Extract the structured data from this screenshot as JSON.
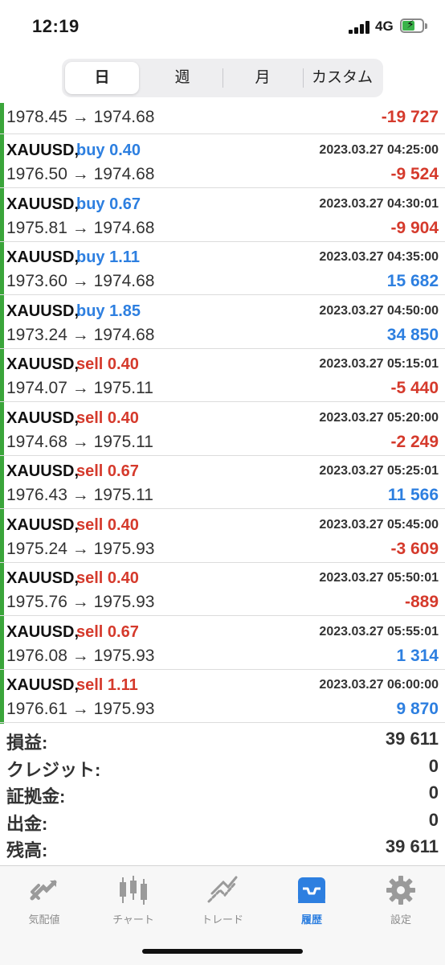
{
  "status_bar": {
    "time": "12:19",
    "network": "4G"
  },
  "segmented": {
    "tabs": [
      {
        "label": "日",
        "active": true
      },
      {
        "label": "週",
        "active": false
      },
      {
        "label": "月",
        "active": false
      },
      {
        "label": "カスタム",
        "active": false
      }
    ]
  },
  "partial_row": {
    "prices": "1978.45 → 1974.68",
    "profit": "-19 727"
  },
  "trades": [
    {
      "symbol": "XAUUSD,",
      "side": "buy 0.40",
      "time": "2023.03.27 04:25:00",
      "prices": "1976.50 → 1974.68",
      "profit": "-9 524"
    },
    {
      "symbol": "XAUUSD,",
      "side": "buy 0.67",
      "time": "2023.03.27 04:30:01",
      "prices": "1975.81 → 1974.68",
      "profit": "-9 904"
    },
    {
      "symbol": "XAUUSD,",
      "side": "buy 1.11",
      "time": "2023.03.27 04:35:00",
      "prices": "1973.60 → 1974.68",
      "profit": "15 682"
    },
    {
      "symbol": "XAUUSD,",
      "side": "buy 1.85",
      "time": "2023.03.27 04:50:00",
      "prices": "1973.24 → 1974.68",
      "profit": "34 850"
    },
    {
      "symbol": "XAUUSD,",
      "side": "sell 0.40",
      "time": "2023.03.27 05:15:01",
      "prices": "1974.07 → 1975.11",
      "profit": "-5 440"
    },
    {
      "symbol": "XAUUSD,",
      "side": "sell 0.40",
      "time": "2023.03.27 05:20:00",
      "prices": "1974.68 → 1975.11",
      "profit": "-2 249"
    },
    {
      "symbol": "XAUUSD,",
      "side": "sell 0.67",
      "time": "2023.03.27 05:25:01",
      "prices": "1976.43 → 1975.11",
      "profit": "11 566"
    },
    {
      "symbol": "XAUUSD,",
      "side": "sell 0.40",
      "time": "2023.03.27 05:45:00",
      "prices": "1975.24 → 1975.93",
      "profit": "-3 609"
    },
    {
      "symbol": "XAUUSD,",
      "side": "sell 0.40",
      "time": "2023.03.27 05:50:01",
      "prices": "1975.76 → 1975.93",
      "profit": "-889"
    },
    {
      "symbol": "XAUUSD,",
      "side": "sell 0.67",
      "time": "2023.03.27 05:55:01",
      "prices": "1976.08 → 1975.93",
      "profit": "1 314"
    },
    {
      "symbol": "XAUUSD,",
      "side": "sell 1.11",
      "time": "2023.03.27 06:00:00",
      "prices": "1976.61 → 1975.93",
      "profit": "9 870"
    }
  ],
  "summary": [
    {
      "label": "損益:",
      "value": "39 611"
    },
    {
      "label": "クレジット:",
      "value": "0"
    },
    {
      "label": "証拠金:",
      "value": "0"
    },
    {
      "label": "出金:",
      "value": "0"
    },
    {
      "label": "残高:",
      "value": "39 611"
    }
  ],
  "tabbar": {
    "items": [
      {
        "label": "気配値",
        "icon": "quotes-icon",
        "active": false
      },
      {
        "label": "チャート",
        "icon": "chart-icon",
        "active": false
      },
      {
        "label": "トレード",
        "icon": "trade-icon",
        "active": false
      },
      {
        "label": "履歴",
        "icon": "history-icon",
        "active": true
      },
      {
        "label": "設定",
        "icon": "settings-icon",
        "active": false
      }
    ]
  },
  "colors": {
    "buy": "#2d7fe0",
    "sell": "#d53a2c",
    "accent_bar": "#3aa53a",
    "active_tab": "#2d7fe0",
    "inactive_tab": "#8d8d8d"
  }
}
